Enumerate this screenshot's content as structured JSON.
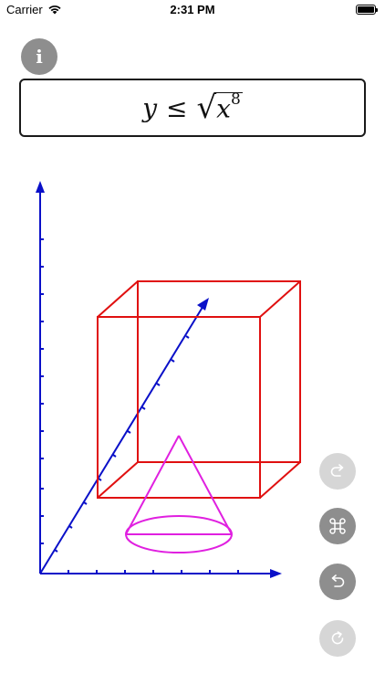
{
  "status": {
    "carrier": "Carrier",
    "time": "2:31 PM"
  },
  "formula": {
    "lhs": "y",
    "relation": "≤",
    "radical_sign": "√",
    "radicand": "x",
    "exponent": "8"
  },
  "icons": {
    "info": "info-icon",
    "redo": "redo-icon",
    "views": "command-icon",
    "undo": "undo-icon",
    "reset": "refresh-icon"
  },
  "colors": {
    "axes": "#0a10c8",
    "cube": "#e01010",
    "cone": "#e020e0",
    "button_disabled": "#d6d6d6",
    "button_enabled": "#8e8e8e"
  },
  "labels": {
    "info_glyph": "i"
  }
}
